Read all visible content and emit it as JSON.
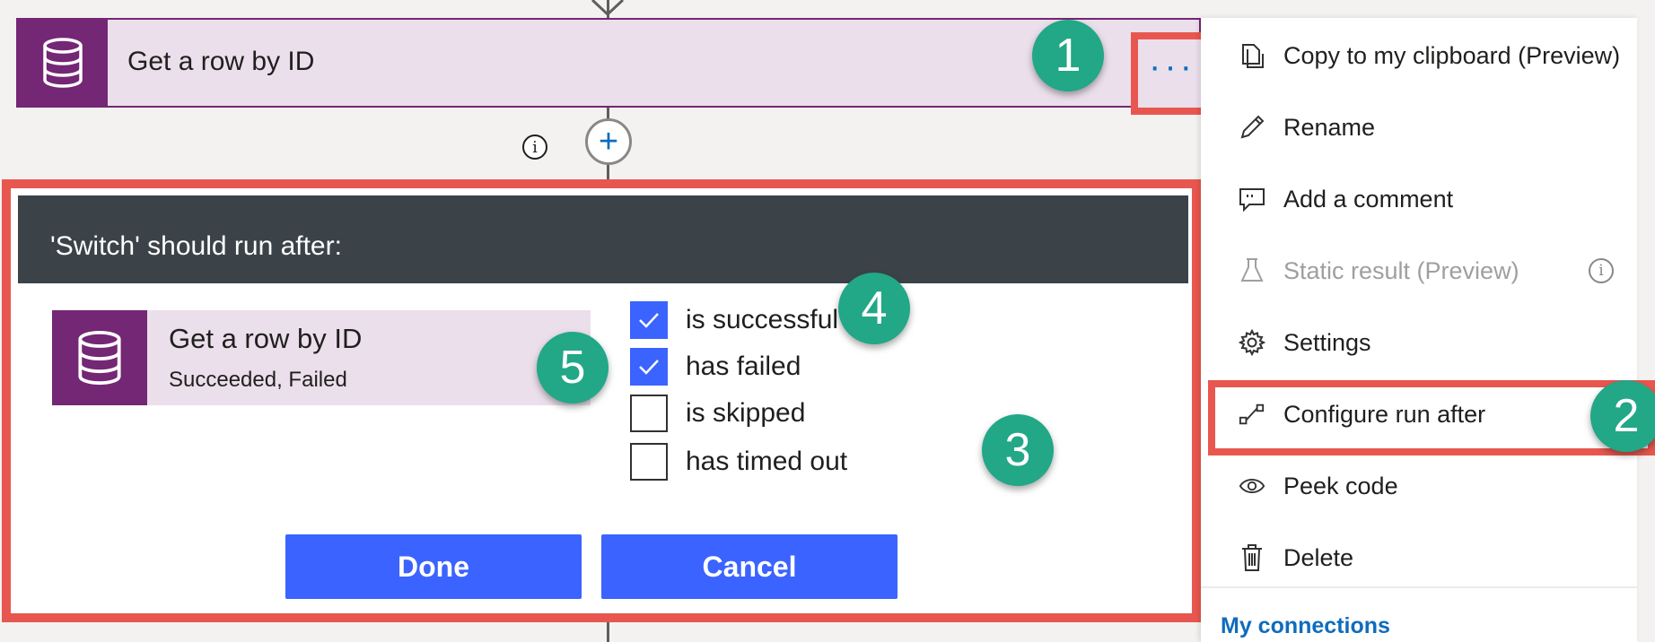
{
  "action": {
    "title": "Get a row by ID",
    "more_label": "···"
  },
  "connector": {
    "info_label": "i",
    "add_label": "+"
  },
  "run_after": {
    "header": "'Switch' should run after:",
    "card_title": "Get a row by ID",
    "card_status": "Succeeded, Failed",
    "options": [
      {
        "label": "is successful",
        "checked": true
      },
      {
        "label": "has failed",
        "checked": true
      },
      {
        "label": "is skipped",
        "checked": false
      },
      {
        "label": "has timed out",
        "checked": false
      }
    ],
    "done_label": "Done",
    "cancel_label": "Cancel"
  },
  "menu": {
    "items": [
      {
        "label": "Copy to my clipboard (Preview)",
        "icon": "copy-icon",
        "enabled": true
      },
      {
        "label": "Rename",
        "icon": "pencil-icon",
        "enabled": true
      },
      {
        "label": "Add a comment",
        "icon": "comment-icon",
        "enabled": true
      },
      {
        "label": "Static result (Preview)",
        "icon": "flask-icon",
        "enabled": false
      },
      {
        "label": "Settings",
        "icon": "gear-icon",
        "enabled": true
      },
      {
        "label": "Configure run after",
        "icon": "run-after-icon",
        "enabled": true
      },
      {
        "label": "Peek code",
        "icon": "eye-icon",
        "enabled": true
      },
      {
        "label": "Delete",
        "icon": "trash-icon",
        "enabled": true
      }
    ],
    "static_info_label": "i",
    "section_label": "My connections"
  },
  "callouts": [
    "1",
    "2",
    "3",
    "4",
    "5"
  ],
  "colors": {
    "highlight": "#e8574f",
    "callout": "#22a787",
    "connector_purple": "#742774",
    "primary_button": "#3b63ff"
  }
}
